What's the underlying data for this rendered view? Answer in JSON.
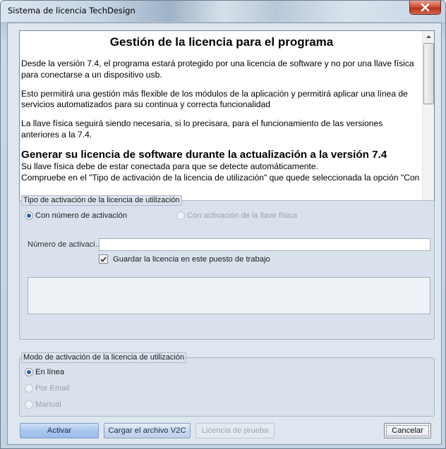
{
  "window": {
    "title": "Sistema de licencia TechDesign"
  },
  "document": {
    "heading": "Gestión de la licencia para el programa",
    "paragraphs": [
      "Desde la versión 7.4, el programa estará protegido por una licencia de software y no por una llave física para conectarse a un dispositivo usb.",
      "Esto permitirá una gestión más flexible de los módulos de la aplicación y permitirá aplicar una línea de servicios automatizados para su continua y correcta funcionalidad",
      "La llave física seguirá siendo necesaria, si lo precisara, para el funcionamiento de las versiones anteriores a la 7.4."
    ],
    "subheading": "Generar su licencia de software durante la actualización a la versión 7.4",
    "lines_after": [
      "Su llave física debe de estar conectada para que se detecte automáticamente.",
      "Compruebe en el \"Tipo de activación de la licencia de utilización\" que quede seleccionada la opción \"Con"
    ]
  },
  "activation_type": {
    "legend": "Tipo de activación de la licencia de utilización",
    "option_number": {
      "label": "Con número de activación",
      "selected": true,
      "enabled": true
    },
    "option_key": {
      "label": "Con activación de la llave física",
      "selected": false,
      "enabled": false
    },
    "number_label": "Número de activaci...",
    "number_value": "",
    "save_checkbox": {
      "label": "Guardar la licencia en este puesto de trabajo",
      "checked": true
    }
  },
  "activation_mode": {
    "legend": "Modo de activación de la licencia de utilización",
    "options": [
      {
        "label": "En línea",
        "selected": true,
        "enabled": true
      },
      {
        "label": "Por Email",
        "selected": false,
        "enabled": false
      },
      {
        "label": "Manual",
        "selected": false,
        "enabled": false
      }
    ]
  },
  "buttons": {
    "activate": "Activar",
    "load_v2c": "Cargar el archivo V2C",
    "trial": "Licencia de prueba",
    "cancel": "Cancelar"
  },
  "icons": {
    "close": "close-icon",
    "scroll_up": "chevron-up-icon",
    "scroll_down": "chevron-down-icon",
    "check": "checkmark-icon"
  }
}
